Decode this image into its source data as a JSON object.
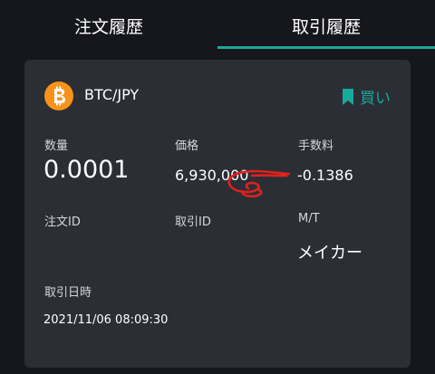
{
  "tabs": {
    "order_history": "注文履歴",
    "trade_history": "取引履歴",
    "active_tab": "trade_history"
  },
  "colors": {
    "accent": "#19a99b",
    "btc": "#f7931a",
    "card_bg": "#2c2e36",
    "page_bg": "#16171c"
  },
  "trade": {
    "coin_icon": "bitcoin-icon",
    "pair": "BTC/JPY",
    "side_icon": "bookmark-icon",
    "side": "買い",
    "quantity_label": "数量",
    "quantity": "0.0001",
    "price_label": "価格",
    "price": "6,930,000",
    "fee_label": "手数料",
    "fee": "-0.1386",
    "order_id_label": "注文ID",
    "trade_id_label": "取引ID",
    "mt_label": "M/T",
    "mt": "メイカー",
    "datetime_label": "取引日時",
    "datetime": "2021/11/06 08:09:30"
  }
}
